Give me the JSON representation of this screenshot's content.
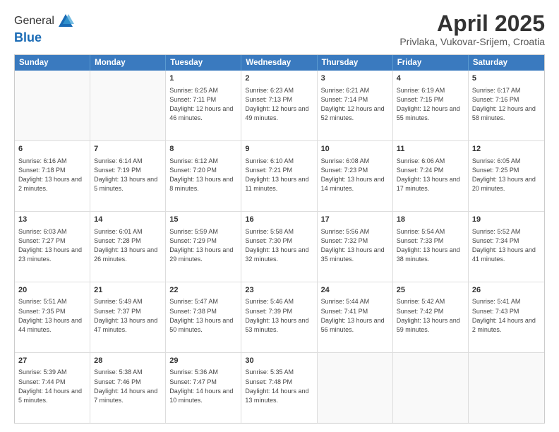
{
  "header": {
    "logo_general": "General",
    "logo_blue": "Blue",
    "title": "April 2025",
    "subtitle": "Privlaka, Vukovar-Srijem, Croatia"
  },
  "days": [
    "Sunday",
    "Monday",
    "Tuesday",
    "Wednesday",
    "Thursday",
    "Friday",
    "Saturday"
  ],
  "weeks": [
    [
      {
        "day": "",
        "content": ""
      },
      {
        "day": "",
        "content": ""
      },
      {
        "day": "1",
        "content": "Sunrise: 6:25 AM\nSunset: 7:11 PM\nDaylight: 12 hours and 46 minutes."
      },
      {
        "day": "2",
        "content": "Sunrise: 6:23 AM\nSunset: 7:13 PM\nDaylight: 12 hours and 49 minutes."
      },
      {
        "day": "3",
        "content": "Sunrise: 6:21 AM\nSunset: 7:14 PM\nDaylight: 12 hours and 52 minutes."
      },
      {
        "day": "4",
        "content": "Sunrise: 6:19 AM\nSunset: 7:15 PM\nDaylight: 12 hours and 55 minutes."
      },
      {
        "day": "5",
        "content": "Sunrise: 6:17 AM\nSunset: 7:16 PM\nDaylight: 12 hours and 58 minutes."
      }
    ],
    [
      {
        "day": "6",
        "content": "Sunrise: 6:16 AM\nSunset: 7:18 PM\nDaylight: 13 hours and 2 minutes."
      },
      {
        "day": "7",
        "content": "Sunrise: 6:14 AM\nSunset: 7:19 PM\nDaylight: 13 hours and 5 minutes."
      },
      {
        "day": "8",
        "content": "Sunrise: 6:12 AM\nSunset: 7:20 PM\nDaylight: 13 hours and 8 minutes."
      },
      {
        "day": "9",
        "content": "Sunrise: 6:10 AM\nSunset: 7:21 PM\nDaylight: 13 hours and 11 minutes."
      },
      {
        "day": "10",
        "content": "Sunrise: 6:08 AM\nSunset: 7:23 PM\nDaylight: 13 hours and 14 minutes."
      },
      {
        "day": "11",
        "content": "Sunrise: 6:06 AM\nSunset: 7:24 PM\nDaylight: 13 hours and 17 minutes."
      },
      {
        "day": "12",
        "content": "Sunrise: 6:05 AM\nSunset: 7:25 PM\nDaylight: 13 hours and 20 minutes."
      }
    ],
    [
      {
        "day": "13",
        "content": "Sunrise: 6:03 AM\nSunset: 7:27 PM\nDaylight: 13 hours and 23 minutes."
      },
      {
        "day": "14",
        "content": "Sunrise: 6:01 AM\nSunset: 7:28 PM\nDaylight: 13 hours and 26 minutes."
      },
      {
        "day": "15",
        "content": "Sunrise: 5:59 AM\nSunset: 7:29 PM\nDaylight: 13 hours and 29 minutes."
      },
      {
        "day": "16",
        "content": "Sunrise: 5:58 AM\nSunset: 7:30 PM\nDaylight: 13 hours and 32 minutes."
      },
      {
        "day": "17",
        "content": "Sunrise: 5:56 AM\nSunset: 7:32 PM\nDaylight: 13 hours and 35 minutes."
      },
      {
        "day": "18",
        "content": "Sunrise: 5:54 AM\nSunset: 7:33 PM\nDaylight: 13 hours and 38 minutes."
      },
      {
        "day": "19",
        "content": "Sunrise: 5:52 AM\nSunset: 7:34 PM\nDaylight: 13 hours and 41 minutes."
      }
    ],
    [
      {
        "day": "20",
        "content": "Sunrise: 5:51 AM\nSunset: 7:35 PM\nDaylight: 13 hours and 44 minutes."
      },
      {
        "day": "21",
        "content": "Sunrise: 5:49 AM\nSunset: 7:37 PM\nDaylight: 13 hours and 47 minutes."
      },
      {
        "day": "22",
        "content": "Sunrise: 5:47 AM\nSunset: 7:38 PM\nDaylight: 13 hours and 50 minutes."
      },
      {
        "day": "23",
        "content": "Sunrise: 5:46 AM\nSunset: 7:39 PM\nDaylight: 13 hours and 53 minutes."
      },
      {
        "day": "24",
        "content": "Sunrise: 5:44 AM\nSunset: 7:41 PM\nDaylight: 13 hours and 56 minutes."
      },
      {
        "day": "25",
        "content": "Sunrise: 5:42 AM\nSunset: 7:42 PM\nDaylight: 13 hours and 59 minutes."
      },
      {
        "day": "26",
        "content": "Sunrise: 5:41 AM\nSunset: 7:43 PM\nDaylight: 14 hours and 2 minutes."
      }
    ],
    [
      {
        "day": "27",
        "content": "Sunrise: 5:39 AM\nSunset: 7:44 PM\nDaylight: 14 hours and 5 minutes."
      },
      {
        "day": "28",
        "content": "Sunrise: 5:38 AM\nSunset: 7:46 PM\nDaylight: 14 hours and 7 minutes."
      },
      {
        "day": "29",
        "content": "Sunrise: 5:36 AM\nSunset: 7:47 PM\nDaylight: 14 hours and 10 minutes."
      },
      {
        "day": "30",
        "content": "Sunrise: 5:35 AM\nSunset: 7:48 PM\nDaylight: 14 hours and 13 minutes."
      },
      {
        "day": "",
        "content": ""
      },
      {
        "day": "",
        "content": ""
      },
      {
        "day": "",
        "content": ""
      }
    ]
  ]
}
